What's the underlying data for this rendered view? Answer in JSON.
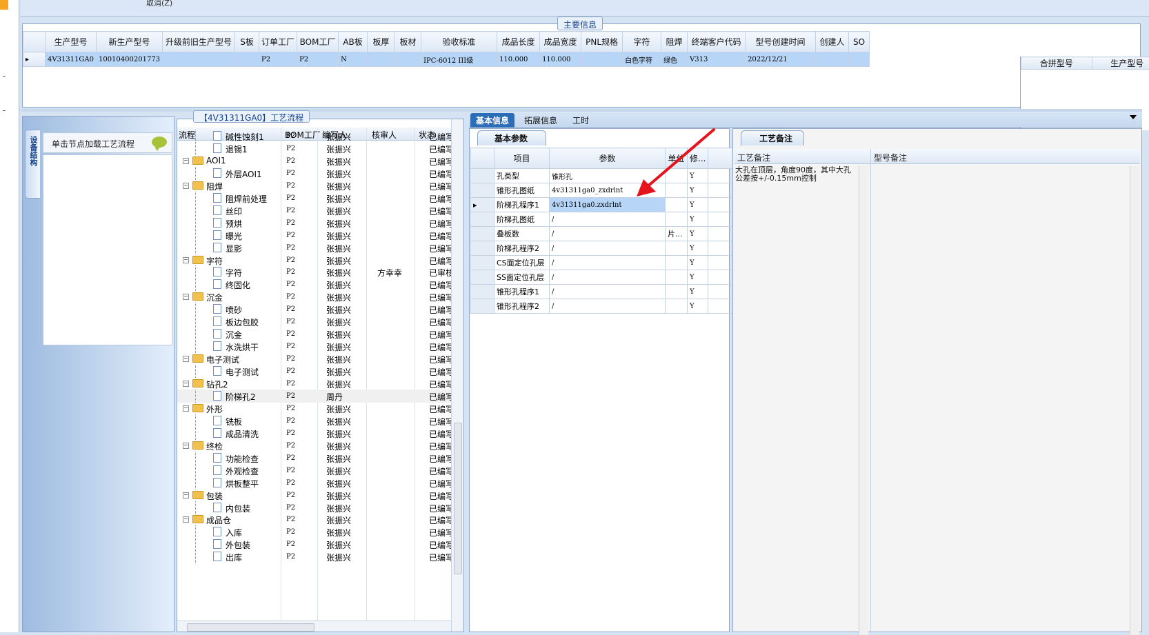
{
  "topbar": {
    "fragment": "取消(Z)"
  },
  "main_info": {
    "title": "主要信息",
    "columns": [
      "生产型号",
      "新生产型号",
      "升级前旧生产型号",
      "S板",
      "订单工厂",
      "BOM工厂",
      "AB板",
      "板厚",
      "板材",
      "验收标准",
      "成品长度",
      "成品宽度",
      "PNL规格",
      "字符",
      "阻焊",
      "终端客户代码",
      "型号创建时间",
      "创建人",
      "SO"
    ],
    "row": [
      "4V31311GA0",
      "10010400201773",
      "",
      "",
      "P2",
      "P2",
      "N",
      "",
      "",
      "IPC-6012 III级",
      "110.000",
      "110.000",
      "",
      "白色字符",
      "绿色",
      "V313",
      "2022/12/21",
      "",
      ""
    ],
    "merge_columns": [
      "合拼型号",
      "生产型号"
    ]
  },
  "device_panel": {
    "tab_label": "设备结构",
    "hint": "单击节点加载工艺流程"
  },
  "process": {
    "title": "【4V31311GA0】工艺流程",
    "headers": [
      "流程",
      "BOM工厂",
      "编写人",
      "核审人",
      "状态"
    ],
    "rows": [
      {
        "level": 2,
        "kind": "doc",
        "name": "碱性蚀刻1",
        "bom": "P2",
        "writer": "张振兴",
        "reviewer": "",
        "status": "已编写"
      },
      {
        "level": 2,
        "kind": "doc",
        "name": "退锡1",
        "bom": "P2",
        "writer": "张振兴",
        "reviewer": "",
        "status": "已编写"
      },
      {
        "level": 1,
        "kind": "folder",
        "name": "AOI1",
        "bom": "P2",
        "writer": "张振兴",
        "reviewer": "",
        "status": "已编写"
      },
      {
        "level": 2,
        "kind": "doc",
        "name": "外层AOI1",
        "bom": "P2",
        "writer": "张振兴",
        "reviewer": "",
        "status": "已编写"
      },
      {
        "level": 1,
        "kind": "folder",
        "name": "阻焊",
        "bom": "P2",
        "writer": "张振兴",
        "reviewer": "",
        "status": "已编写"
      },
      {
        "level": 2,
        "kind": "doc",
        "name": "阻焊前处理",
        "bom": "P2",
        "writer": "张振兴",
        "reviewer": "",
        "status": "已编写"
      },
      {
        "level": 2,
        "kind": "doc",
        "name": "丝印",
        "bom": "P2",
        "writer": "张振兴",
        "reviewer": "",
        "status": "已编写"
      },
      {
        "level": 2,
        "kind": "doc",
        "name": "预烘",
        "bom": "P2",
        "writer": "张振兴",
        "reviewer": "",
        "status": "已编写"
      },
      {
        "level": 2,
        "kind": "doc",
        "name": "曝光",
        "bom": "P2",
        "writer": "张振兴",
        "reviewer": "",
        "status": "已编写"
      },
      {
        "level": 2,
        "kind": "doc",
        "name": "显影",
        "bom": "P2",
        "writer": "张振兴",
        "reviewer": "",
        "status": "已编写"
      },
      {
        "level": 1,
        "kind": "folder",
        "name": "字符",
        "bom": "P2",
        "writer": "张振兴",
        "reviewer": "",
        "status": "已编写"
      },
      {
        "level": 2,
        "kind": "doc",
        "name": "字符",
        "bom": "P2",
        "writer": "张振兴",
        "reviewer": "方幸幸",
        "status": "已审核"
      },
      {
        "level": 2,
        "kind": "doc",
        "name": "终固化",
        "bom": "P2",
        "writer": "张振兴",
        "reviewer": "",
        "status": "已编写"
      },
      {
        "level": 1,
        "kind": "folder",
        "name": "沉金",
        "bom": "P2",
        "writer": "张振兴",
        "reviewer": "",
        "status": "已编写"
      },
      {
        "level": 2,
        "kind": "doc",
        "name": "喷砂",
        "bom": "P2",
        "writer": "张振兴",
        "reviewer": "",
        "status": "已编写"
      },
      {
        "level": 2,
        "kind": "doc",
        "name": "板边包胶",
        "bom": "P2",
        "writer": "张振兴",
        "reviewer": "",
        "status": "已编写"
      },
      {
        "level": 2,
        "kind": "doc",
        "name": "沉金",
        "bom": "P2",
        "writer": "张振兴",
        "reviewer": "",
        "status": "已编写"
      },
      {
        "level": 2,
        "kind": "doc",
        "name": "水洗烘干",
        "bom": "P2",
        "writer": "张振兴",
        "reviewer": "",
        "status": "已编写"
      },
      {
        "level": 1,
        "kind": "folder",
        "name": "电子测试",
        "bom": "P2",
        "writer": "张振兴",
        "reviewer": "",
        "status": "已编写"
      },
      {
        "level": 2,
        "kind": "doc",
        "name": "电子测试",
        "bom": "P2",
        "writer": "张振兴",
        "reviewer": "",
        "status": "已编写"
      },
      {
        "level": 1,
        "kind": "folder",
        "name": "钻孔2",
        "bom": "P2",
        "writer": "张振兴",
        "reviewer": "",
        "status": "已编写"
      },
      {
        "level": 2,
        "kind": "doc",
        "name": "阶梯孔2",
        "bom": "P2",
        "writer": "周丹",
        "reviewer": "",
        "status": "已编写",
        "highlight": true
      },
      {
        "level": 1,
        "kind": "folder",
        "name": "外形",
        "bom": "P2",
        "writer": "张振兴",
        "reviewer": "",
        "status": "已编写"
      },
      {
        "level": 2,
        "kind": "doc",
        "name": "铣板",
        "bom": "P2",
        "writer": "张振兴",
        "reviewer": "",
        "status": "已编写"
      },
      {
        "level": 2,
        "kind": "doc",
        "name": "成品清洗",
        "bom": "P2",
        "writer": "张振兴",
        "reviewer": "",
        "status": "已编写"
      },
      {
        "level": 1,
        "kind": "folder",
        "name": "终检",
        "bom": "P2",
        "writer": "张振兴",
        "reviewer": "",
        "status": "已编写"
      },
      {
        "level": 2,
        "kind": "doc",
        "name": "功能检查",
        "bom": "P2",
        "writer": "张振兴",
        "reviewer": "",
        "status": "已编写"
      },
      {
        "level": 2,
        "kind": "doc",
        "name": "外观检查",
        "bom": "P2",
        "writer": "张振兴",
        "reviewer": "",
        "status": "已编写"
      },
      {
        "level": 2,
        "kind": "doc",
        "name": "烘板整平",
        "bom": "P2",
        "writer": "张振兴",
        "reviewer": "",
        "status": "已编写"
      },
      {
        "level": 1,
        "kind": "folder",
        "name": "包装",
        "bom": "P2",
        "writer": "张振兴",
        "reviewer": "",
        "status": "已编写"
      },
      {
        "level": 2,
        "kind": "doc",
        "name": "内包装",
        "bom": "P2",
        "writer": "张振兴",
        "reviewer": "",
        "status": "已编写"
      },
      {
        "level": 1,
        "kind": "folder",
        "name": "成品仓",
        "bom": "P2",
        "writer": "张振兴",
        "reviewer": "",
        "status": "已编写"
      },
      {
        "level": 2,
        "kind": "doc",
        "name": "入库",
        "bom": "P2",
        "writer": "张振兴",
        "reviewer": "",
        "status": "已编写"
      },
      {
        "level": 2,
        "kind": "doc",
        "name": "外包装",
        "bom": "P2",
        "writer": "张振兴",
        "reviewer": "",
        "status": "已编写"
      },
      {
        "level": 2,
        "kind": "doc",
        "name": "出库",
        "bom": "P2",
        "writer": "张振兴",
        "reviewer": "",
        "status": "已编写"
      }
    ]
  },
  "tabs": {
    "basic": "基本信息",
    "extended": "拓展信息",
    "hours": "工时"
  },
  "basic_params": {
    "tab_label": "基本参数",
    "headers": [
      "项目",
      "参数",
      "单位",
      "修..."
    ],
    "rows": [
      {
        "item": "孔类型",
        "value": "锥形孔",
        "unit": "",
        "mod": "Y"
      },
      {
        "item": "锥形孔图纸",
        "value": "4v31311ga0_zxdrlnt",
        "unit": "",
        "mod": "Y"
      },
      {
        "item": "阶梯孔程序1",
        "value": "4v31311ga0.zxdrlnt",
        "unit": "",
        "mod": "Y",
        "selected": true
      },
      {
        "item": "阶梯孔图纸",
        "value": "/",
        "unit": "",
        "mod": "Y"
      },
      {
        "item": "叠板数",
        "value": "/",
        "unit": "片...",
        "mod": "Y"
      },
      {
        "item": "阶梯孔程序2",
        "value": "/",
        "unit": "",
        "mod": "Y"
      },
      {
        "item": "CS面定位孔层",
        "value": "/",
        "unit": "",
        "mod": "Y"
      },
      {
        "item": "SS面定位孔层",
        "value": "/",
        "unit": "",
        "mod": "Y"
      },
      {
        "item": "锥形孔程序1",
        "value": "/",
        "unit": "",
        "mod": "Y"
      },
      {
        "item": "锥形孔程序2",
        "value": "/",
        "unit": "",
        "mod": "Y"
      }
    ]
  },
  "process_notes": {
    "tab_label": "工艺备注",
    "col1": "工艺备注",
    "col2": "型号备注",
    "note_text": "大孔在顶层，角度90度，其中大孔公差按+/-0.15mm控制"
  },
  "colors": {
    "accent": "#2d6cb6",
    "selection": "#b7d6f7",
    "arrow": "#e4131c",
    "folder": "#f2c04d"
  }
}
